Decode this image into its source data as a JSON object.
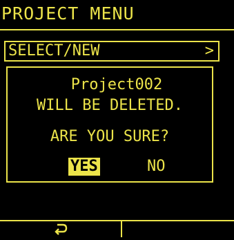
{
  "title": "PROJECT MENU",
  "menu": {
    "label": "SELECT/NEW",
    "arrow": ">"
  },
  "dialog": {
    "project_name": "Project002",
    "message": "WILL BE DELETED.",
    "question": "ARE YOU SURE?",
    "yes_label": "YES",
    "no_label": "NO"
  },
  "footer": {
    "left_icon": "return-arrow-icon"
  },
  "colors": {
    "foreground": "#ece44a",
    "background": "#000000"
  }
}
